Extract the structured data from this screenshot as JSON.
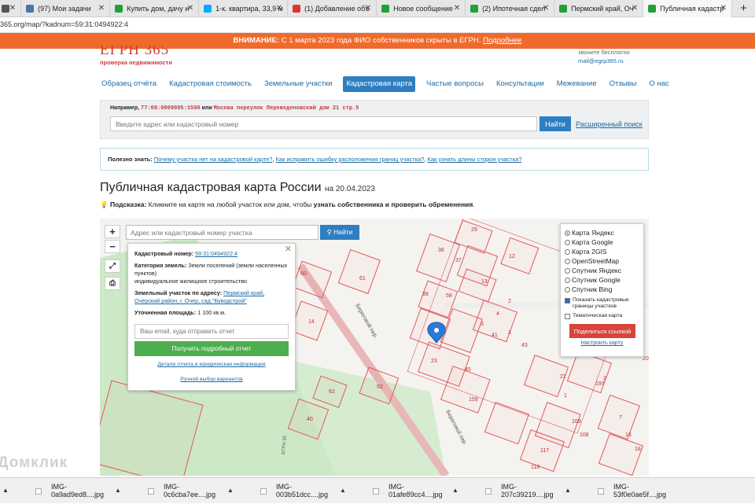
{
  "browser": {
    "tabs": [
      {
        "label": "",
        "icon": "grid-icon",
        "color": "#555555"
      },
      {
        "label": "(97) Мои задачи",
        "icon": "vk-icon",
        "color": "#4a76a8"
      },
      {
        "label": "Купить дом, дачу и",
        "icon": "domclick-icon",
        "color": "#21a038"
      },
      {
        "label": "1-к. квартира, 33,9 м",
        "icon": "avito-icon",
        "color": "#00aaff"
      },
      {
        "label": "(1) Добавление объ",
        "icon": "shield-icon",
        "color": "#d33"
      },
      {
        "label": "Новое сообщение",
        "icon": "chat-icon",
        "color": "#21a038"
      },
      {
        "label": "(2) Ипотечная сдел",
        "icon": "chat-icon",
        "color": "#21a038"
      },
      {
        "label": "Пермский край, Оч",
        "icon": "check-icon",
        "color": "#21a038"
      },
      {
        "label": "Публичная кадастр",
        "icon": "check-icon",
        "color": "#21a038"
      }
    ],
    "url": "365.org/map/?kadnum=59:31:0494922:4"
  },
  "banner": {
    "bold": "ВНИМАНИЕ:",
    "text": " С 1 марта 2023 года ФИО собственников скрыты в ЕГРН. ",
    "link": "Подробнее"
  },
  "header": {
    "logo": "ЕГРН 365",
    "logo_sub": "проверка недвижимости",
    "contact_note": "звоните бесплатно",
    "email": "mail@egrp365.ru"
  },
  "nav": [
    {
      "label": "Образец отчёта",
      "active": false
    },
    {
      "label": "Кадастровая стоимость",
      "active": false
    },
    {
      "label": "Земельные участки",
      "active": false
    },
    {
      "label": "Кадастровая карта",
      "active": true
    },
    {
      "label": "Частые вопросы",
      "active": false
    },
    {
      "label": "Консультации",
      "active": false
    },
    {
      "label": "Межевание",
      "active": false
    },
    {
      "label": "Отзывы",
      "active": false
    },
    {
      "label": "О нас",
      "active": false
    }
  ],
  "search": {
    "example_prefix": "Например,",
    "example_num": "77:08:0009005:1590",
    "example_or": "или",
    "example_addr": "Москва переулок Переведеновский дом 21 стр.5",
    "placeholder": "Введите адрес или кадастровый номер",
    "button": "Найти",
    "advanced": "Расширенный поиск"
  },
  "info": {
    "label": "Полезно знать:",
    "links": [
      "Почему участка нет на кадастровой карте?",
      "Как исправить ошибку расположения границ участка?",
      "Как узнать длины сторон участка?"
    ]
  },
  "page": {
    "title": "Публичная кадастровая карта России",
    "date": "на 20.04.2023",
    "hint_label": "Подсказка:",
    "hint_text": " Кликните на карте на любой участок или дом, чтобы ",
    "hint_bold": "узнать собственника и проверить обременения",
    "hint_end": "."
  },
  "map": {
    "search_placeholder": "Адрес или кадастровый номер участка",
    "search_button": "Найти",
    "zoom_in": "+",
    "zoom_out": "−",
    "popup": {
      "kadnum_label": "Кадастровый номер:",
      "kadnum": "59:31:0494922:4",
      "cat_label": "Категория земель:",
      "cat": " Земли поселений (земли населенных пунктов)",
      "use": "индивидуальное жилищное строительство",
      "addr_label": "Земельный участок по адресу:",
      "addr": "Пермский край, Очерский район, г. Очер, сад \"Буводстрой\"",
      "area_label": "Уточненная площадь:",
      "area": " 1 100 кв.м.",
      "email_placeholder": "Ваш email, куда отправить отчет",
      "report_button": "Получить подробный отчет",
      "details_link": "Детали отчета и юридическая информация",
      "manual_link": "Ручной выбор вариантов"
    },
    "layers": {
      "options": [
        {
          "label": "Карта Яндекс",
          "checked": true
        },
        {
          "label": "Карта Google",
          "checked": false
        },
        {
          "label": "Карта 2GIS",
          "checked": false
        },
        {
          "label": "OpenStreetMap",
          "checked": false
        },
        {
          "label": "Спутник Яндекс",
          "checked": false
        },
        {
          "label": "Спутник Google",
          "checked": false
        },
        {
          "label": "Спутник Bing",
          "checked": false
        }
      ],
      "show_borders": "Показать кадастровые границы участков",
      "show_borders_checked": true,
      "thematic": "Тематическая карта",
      "thematic_checked": false,
      "share": "Поделиться ссылкой",
      "configure": "Настроить карту"
    },
    "street": "Береговой пер.",
    "street2": "Береговой пер.",
    "parcel_labels": [
      "29",
      "36",
      "37",
      "12",
      "13",
      "58",
      "60",
      "61",
      "39",
      "14",
      "4",
      "5",
      "2",
      "3",
      "41",
      "23",
      "43",
      "45",
      "52",
      "159",
      "21",
      "40",
      "62",
      "1",
      "109",
      "108",
      "117",
      "118",
      "16",
      "18",
      "7",
      "20",
      "2",
      "197"
    ],
    "road_label": "ЕГРН 35"
  },
  "downloads": [
    "IMG-0a9ad9ed8....jpg",
    "IMG-0c6cba7ee....jpg",
    "IMG-003b51dcc....jpg",
    "IMG-01afe89cc4....jpg",
    "IMG-207c39219....jpg",
    "IMG-53f0e0ae5f....jpg"
  ],
  "watermark": "Домклик",
  "colors": {
    "banner": "#ef6a2b",
    "accent": "#2f7fc0",
    "brand": "#d23d3d",
    "report": "#4cae4c",
    "share": "#d9443a",
    "parcel_line": "#e05a5a",
    "green_area": "#cde8c6"
  }
}
